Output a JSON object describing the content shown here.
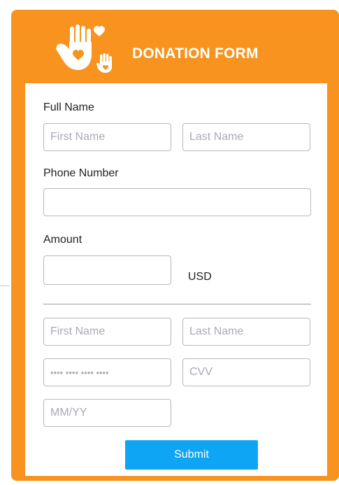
{
  "header": {
    "title": "DONATION FORM",
    "logo_icon": "hands-heart-icon"
  },
  "form": {
    "full_name_label": "Full Name",
    "first_name_placeholder": "First Name",
    "last_name_placeholder": "Last Name",
    "phone_label": "Phone Number",
    "phone_placeholder": "",
    "amount_label": "Amount",
    "amount_placeholder": "",
    "currency": "USD"
  },
  "payment": {
    "card_first_name_placeholder": "First Name",
    "card_last_name_placeholder": "Last Name",
    "card_number_placeholder": "•••• •••• •••• ••••",
    "cvv_placeholder": "CVV",
    "expiry_placeholder": "MM/YY"
  },
  "submit_label": "Submit",
  "colors": {
    "accent": "#f7931e",
    "button": "#0fa5f5"
  }
}
